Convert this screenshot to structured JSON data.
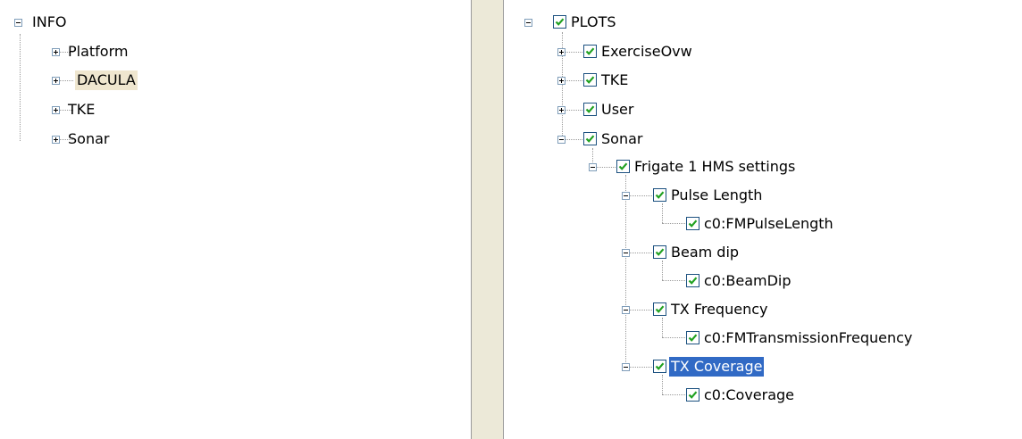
{
  "left_tree": {
    "root": {
      "label": "INFO",
      "expanded": true
    },
    "items": [
      {
        "label": "Platform",
        "expanded": false
      },
      {
        "label": "DACULA",
        "expanded": false,
        "hover": true
      },
      {
        "label": "TKE",
        "expanded": false
      },
      {
        "label": "Sonar",
        "expanded": false
      }
    ]
  },
  "right_tree": {
    "root": {
      "label": "PLOTS",
      "checked": true,
      "expanded": true
    },
    "items": [
      {
        "label": "ExerciseOvw",
        "checked": true,
        "expanded": false
      },
      {
        "label": "TKE",
        "checked": true,
        "expanded": false
      },
      {
        "label": "User",
        "checked": true,
        "expanded": false
      },
      {
        "label": "Sonar",
        "checked": true,
        "expanded": true
      },
      {
        "label": "Frigate 1 HMS settings",
        "checked": true,
        "expanded": true
      },
      {
        "label": "Pulse Length",
        "checked": true,
        "expanded": true
      },
      {
        "label": "c0:FMPulseLength",
        "checked": true
      },
      {
        "label": "Beam dip",
        "checked": true,
        "expanded": true
      },
      {
        "label": "c0:BeamDip",
        "checked": true
      },
      {
        "label": "TX Frequency",
        "checked": true,
        "expanded": true
      },
      {
        "label": "c0:FMTransmissionFrequency",
        "checked": true
      },
      {
        "label": "TX Coverage",
        "checked": true,
        "expanded": true,
        "selected": true
      },
      {
        "label": "c0:Coverage",
        "checked": true
      }
    ]
  },
  "colors": {
    "selection": "#316ac5",
    "hover": "#efe6cf",
    "check": "#21a121",
    "splitter": "#ece9d8"
  }
}
